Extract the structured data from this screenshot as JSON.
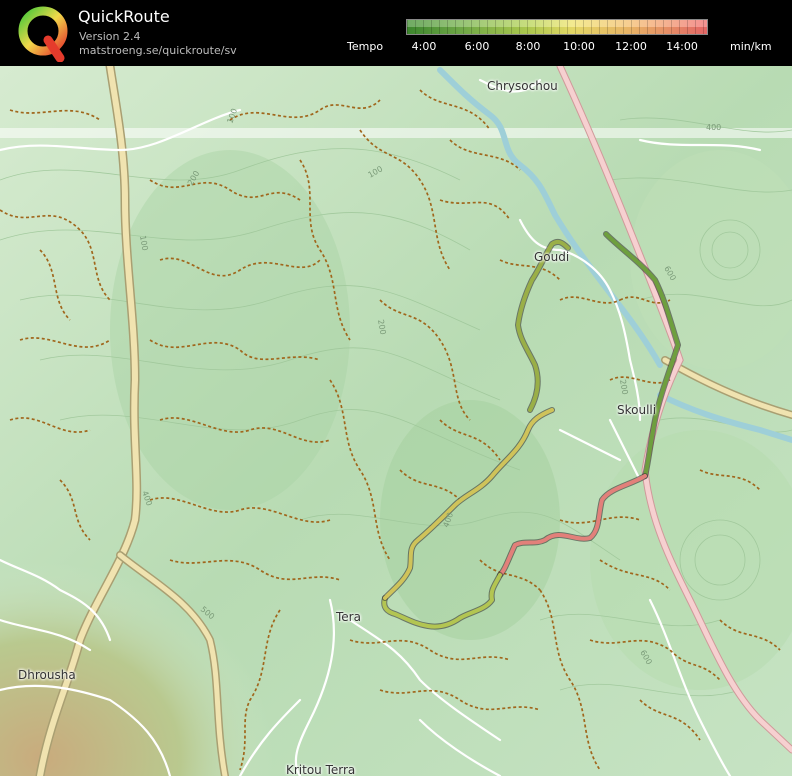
{
  "app": {
    "title": "QuickRoute",
    "version": "Version 2.4",
    "url": "matstroeng.se/quickroute/sv"
  },
  "legend": {
    "caption": "Tempo",
    "unit": "min/km",
    "ticks": [
      "4:00",
      "6:00",
      "8:00",
      "10:00",
      "12:00",
      "14:00"
    ]
  },
  "map": {
    "places": [
      "Chrysochou",
      "Goudi",
      "Skoulli",
      "Tera",
      "Dhrousha",
      "Kritou Terra"
    ],
    "contour_labels": [
      "100",
      "200",
      "100",
      "100",
      "200",
      "200",
      "400",
      "400",
      "500",
      "600",
      "600",
      "400"
    ]
  },
  "colors": {
    "fast": "#3f8d2f",
    "medium": "#efe36b",
    "slow": "#ef6c6c",
    "terrain_low": "#cfe6c9",
    "terrain_high": "#c8a878",
    "trail": "#a0661c",
    "main_road": "#f0e3b0",
    "highway": "#f4c4c4",
    "river": "#9ecfd8"
  }
}
